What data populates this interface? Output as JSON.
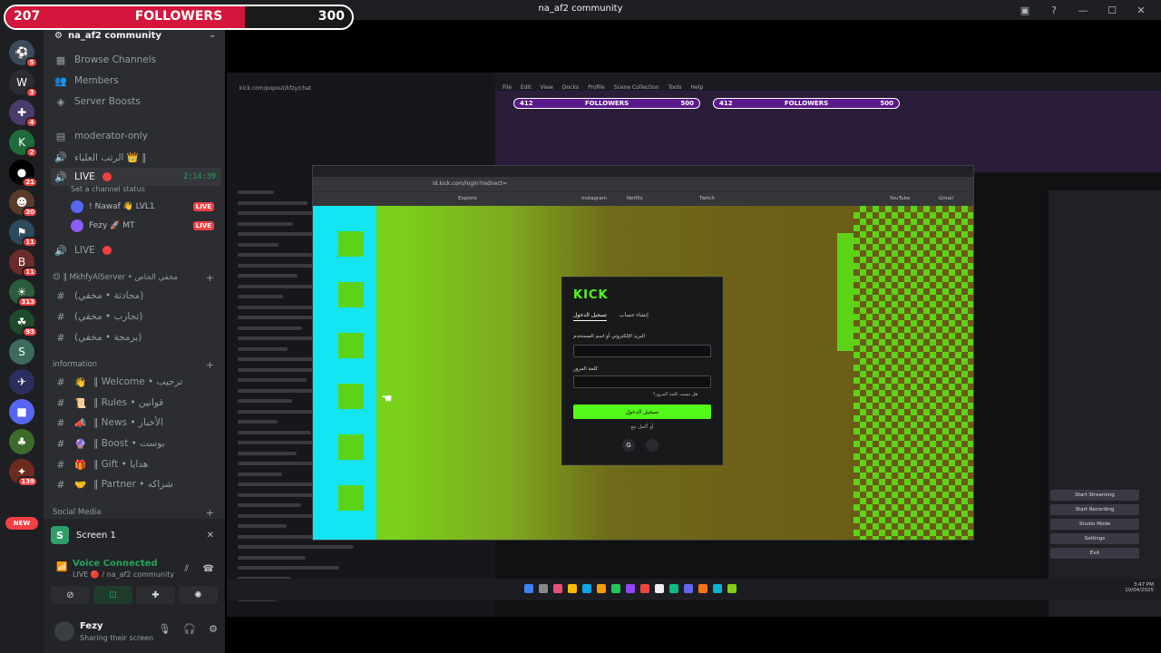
{
  "window": {
    "title": "na_af2 community"
  },
  "followers": {
    "current": "207",
    "label": "FOLLOWERS",
    "goal": "300",
    "progress": 0.69
  },
  "rail": {
    "servers": [
      {
        "glyph": "⚽",
        "badge": "5"
      },
      {
        "glyph": "W",
        "badge": "3"
      },
      {
        "glyph": "✚",
        "badge": "4"
      },
      {
        "glyph": "K",
        "badge": "2"
      },
      {
        "glyph": "●",
        "badge": "21"
      },
      {
        "glyph": "☻",
        "badge": "20"
      },
      {
        "glyph": "⚑",
        "badge": "11"
      },
      {
        "glyph": "B",
        "badge": "11"
      },
      {
        "glyph": "☀",
        "badge": "313"
      },
      {
        "glyph": "☘",
        "badge": "93"
      },
      {
        "glyph": "S",
        "badge": ""
      },
      {
        "glyph": "✈",
        "badge": ""
      },
      {
        "glyph": "■",
        "badge": ""
      },
      {
        "glyph": "♣",
        "badge": ""
      },
      {
        "glyph": "✦",
        "badge": "139"
      }
    ],
    "new_label": "NEW"
  },
  "sidebar": {
    "guild_name": "na_af2 community",
    "top_items": [
      {
        "icon": "▦",
        "label": "Browse Channels"
      },
      {
        "icon": "👥",
        "label": "Members"
      },
      {
        "icon": "◈",
        "label": "Server Boosts"
      }
    ],
    "moderator": {
      "icon": "▤",
      "label": "moderator-only"
    },
    "rank": {
      "icon": "🔊",
      "label": "الرتب العلياء 👑 ‖"
    },
    "live_channel": {
      "label": "LIVE",
      "time": "2:14:39",
      "status": "Set a channel status"
    },
    "voice_users": [
      {
        "name": "! Nawaf 👋 LVL1",
        "tag": "LIVE"
      },
      {
        "name": "Fezy 🚀 MT",
        "tag": "LIVE"
      }
    ],
    "live2": {
      "label": "LIVE"
    },
    "cat_mkhfy": "😊 ‖ MkhfyAlServer • مخفي الخاص",
    "mkhfy_channels": [
      "(محادثة • مخفي)",
      "(تجارب • مخفي)",
      "(برمجة • مخفي)"
    ],
    "cat_information": "information",
    "info_channels": [
      {
        "emoji": "👋",
        "label": "‖ Welcome • ترحيب"
      },
      {
        "emoji": "📜",
        "label": "‖ Rules • قوانين"
      },
      {
        "emoji": "📣",
        "label": "‖ News • الأخبار"
      },
      {
        "emoji": "🔮",
        "label": "‖ Boost • بوست"
      },
      {
        "emoji": "🎁",
        "label": "‖ Gift • هدايا"
      },
      {
        "emoji": "🤝",
        "label": "‖ Partner • شراكه"
      }
    ],
    "cat_social": "Social Media",
    "screen_card": "Screen 1",
    "voice_connected": "Voice Connected",
    "voice_sub": "LIVE 🔴 / na_af2 community",
    "user_name": "Fezy",
    "user_status": "Sharing their screen"
  },
  "stream": {
    "obs_menu": [
      "File",
      "Edit",
      "View",
      "Docks",
      "Profile",
      "Scene Collection",
      "Tools",
      "Help"
    ],
    "chat_url": "kick.com/popout/kfzy/chat",
    "preview_bars": [
      {
        "cur": "412",
        "label": "FOLLOWERS",
        "max": "500"
      }
    ],
    "obs_controls": [
      "Start Streaming",
      "Start Recording",
      "Studio Mode",
      "Settings",
      "Exit"
    ],
    "browser_url": "id.kick.com/login?redirect=",
    "bookmarks": [
      "Explore",
      "Instagram",
      "Netflix",
      "Twitch",
      "YouTube",
      "Gmail"
    ],
    "clock": "3:47 PM",
    "date": "10/04/2025"
  },
  "login": {
    "logo": "KICK",
    "tab_login": "تسجيل الدخول",
    "tab_signup": "إنشاء حساب",
    "email_label": "البريد الإلكتروني أو اسم المستخدم",
    "password_label": "كلمة المرور",
    "forgot": "هل نسيت كلمة المرور؟",
    "submit": "تسجيل الدخول",
    "or": "أو أكمل مع"
  },
  "colors": {
    "accent_red": "#d4163c",
    "kick_green": "#53fc18",
    "discord_green": "#23a55a"
  }
}
